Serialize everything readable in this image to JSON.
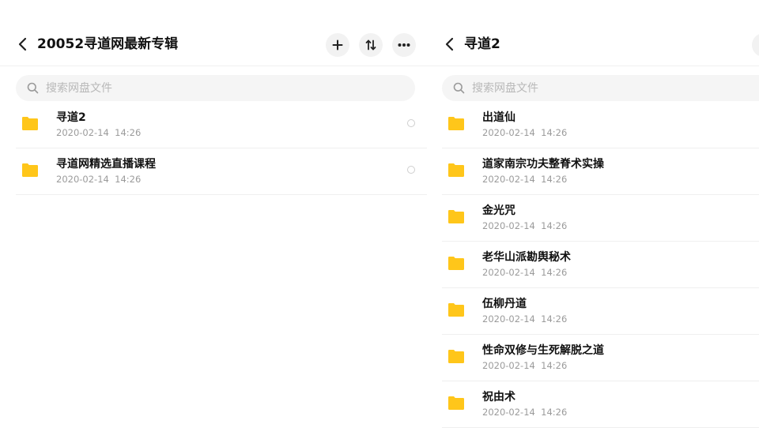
{
  "left_panel": {
    "title": "20052寻道网最新专辑",
    "search_placeholder": "搜索网盘文件",
    "files": [
      {
        "name": "寻道2",
        "date": "2020-02-14  14:26"
      },
      {
        "name": "寻道网精选直播课程",
        "date": "2020-02-14  14:26"
      }
    ]
  },
  "right_panel": {
    "title": "寻道2",
    "search_placeholder": "搜索网盘文件",
    "files": [
      {
        "name": "出道仙",
        "date": "2020-02-14  14:26"
      },
      {
        "name": "道家南宗功夫整脊术实操",
        "date": "2020-02-14  14:26"
      },
      {
        "name": "金光咒",
        "date": "2020-02-14  14:26"
      },
      {
        "name": "老华山派勘舆秘术",
        "date": "2020-02-14  14:26"
      },
      {
        "name": "伍柳丹道",
        "date": "2020-02-14  14:26"
      },
      {
        "name": "性命双修与生死解脱之道",
        "date": "2020-02-14  14:26"
      },
      {
        "name": "祝由术",
        "date": "2020-02-14  14:26"
      }
    ]
  },
  "icons": {
    "back": "chevron-left-icon",
    "add": "plus-icon",
    "sort": "sort-icon",
    "more": "more-horizontal-icon",
    "search": "search-icon",
    "folder": "folder-icon"
  },
  "colors": {
    "folder": "#FFC61A",
    "title_text": "#111111",
    "secondary_text": "#9B9B9B",
    "search_bg": "#F5F5F5",
    "button_bg": "#F2F2F2"
  }
}
